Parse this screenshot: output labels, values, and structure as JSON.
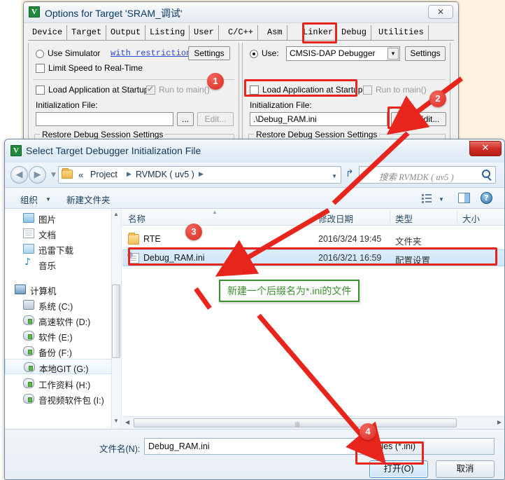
{
  "options_dialog": {
    "title": "Options for Target 'SRAM_调试'",
    "icon": "keil-uvision-icon",
    "close_label": "✕",
    "tabs": [
      {
        "label": "Device",
        "active": false
      },
      {
        "label": "Target",
        "active": false
      },
      {
        "label": "Output",
        "active": false
      },
      {
        "label": "Listing",
        "active": false
      },
      {
        "label": "User",
        "active": false
      },
      {
        "label": "C/C++",
        "active": false
      },
      {
        "label": "Asm",
        "active": false
      },
      {
        "label": "Linker",
        "active": false
      },
      {
        "label": "Debug",
        "active": true
      },
      {
        "label": "Utilities",
        "active": false
      }
    ],
    "left_panel": {
      "use_simulator_label": "Use Simulator",
      "with_restrictions_link": "with restrictions",
      "settings_button": "Settings",
      "limit_speed_label": "Limit Speed to Real-Time",
      "load_app_label": "Load Application at Startup",
      "run_to_main_label": "Run to main()",
      "init_file_label": "Initialization File:",
      "init_file_value": "",
      "browse_button": "...",
      "edit_button": "Edit...",
      "restore_group_title": "Restore Debug Session Settings"
    },
    "right_panel": {
      "use_label": "Use:",
      "debugger_value": "CMSIS-DAP Debugger",
      "settings_button": "Settings",
      "load_app_label": "Load Application at Startup",
      "run_to_main_label": "Run to main()",
      "init_file_label": "Initialization File:",
      "init_file_value": ".\\Debug_RAM.ini",
      "browse_button": "...",
      "edit_button": "Edit...",
      "restore_group_title": "Restore Debug Session Settings"
    }
  },
  "file_dialog": {
    "title": "Select Target Debugger Initialization File",
    "icon": "keil-uvision-icon",
    "close_label": "✕",
    "nav": {
      "back_icon": "back-arrow-icon",
      "forward_icon": "forward-arrow-icon",
      "history_icon": "chevron-down-icon",
      "breadcrumb_prefix": "«",
      "breadcrumbs": [
        "Project",
        "RVMDK ( uv5 )"
      ],
      "refresh_icon": "refresh-icon",
      "search_placeholder": "搜索 RVMDK ( uv5 )",
      "search_value": ""
    },
    "toolbar": {
      "organize_label": "组织",
      "new_folder_label": "新建文件夹",
      "view_icon": "list-view-icon",
      "preview_icon": "preview-pane-icon",
      "help_icon": "help-icon"
    },
    "sidebar": [
      {
        "label": "图片",
        "icon": "pictures-icon",
        "selected": false,
        "indent": 26
      },
      {
        "label": "文档",
        "icon": "documents-icon",
        "selected": false,
        "indent": 26
      },
      {
        "label": "迅雷下载",
        "icon": "downloads-icon",
        "selected": false,
        "indent": 26
      },
      {
        "label": "音乐",
        "icon": "music-icon",
        "selected": false,
        "indent": 26
      },
      {
        "label": "计算机",
        "icon": "computer-icon",
        "selected": false,
        "indent": 14
      },
      {
        "label": "系统 (C:)",
        "icon": "system-drive-icon",
        "selected": false,
        "indent": 26
      },
      {
        "label": "高速软件 (D:)",
        "icon": "drive-icon",
        "selected": false,
        "indent": 26
      },
      {
        "label": "软件 (E:)",
        "icon": "drive-icon",
        "selected": false,
        "indent": 26
      },
      {
        "label": "备份 (F:)",
        "icon": "drive-icon",
        "selected": false,
        "indent": 26
      },
      {
        "label": "本地GIT (G:)",
        "icon": "drive-icon",
        "selected": true,
        "indent": 26
      },
      {
        "label": "工作资料 (H:)",
        "icon": "drive-icon",
        "selected": false,
        "indent": 26
      },
      {
        "label": "音视频软件包 (I:)",
        "icon": "drive-icon",
        "selected": false,
        "indent": 26
      }
    ],
    "columns": [
      {
        "label": "名称"
      },
      {
        "label": "修改日期"
      },
      {
        "label": "类型"
      },
      {
        "label": "大小"
      }
    ],
    "files": [
      {
        "name": "RTE",
        "date": "2016/3/24 19:45",
        "type": "文件夹",
        "size": "",
        "icon": "folder-icon",
        "selected": false
      },
      {
        "name": "Debug_RAM.ini",
        "date": "2016/3/21 16:59",
        "type": "配置设置",
        "size": "",
        "icon": "ini-file-icon",
        "selected": true
      }
    ],
    "footer": {
      "filename_label": "文件名(N):",
      "filename_value": "Debug_RAM.ini",
      "filter_value": "Files (*.ini)",
      "open_button": "打开(O)",
      "cancel_button": "取消"
    }
  },
  "annotations": {
    "badges": [
      {
        "num": "1"
      },
      {
        "num": "2"
      },
      {
        "num": "3"
      },
      {
        "num": "4"
      }
    ],
    "green_note": "新建一个后缀名为*.ini的文件",
    "highlight_color": "#e8251c",
    "note_color": "#3c8f2f"
  }
}
